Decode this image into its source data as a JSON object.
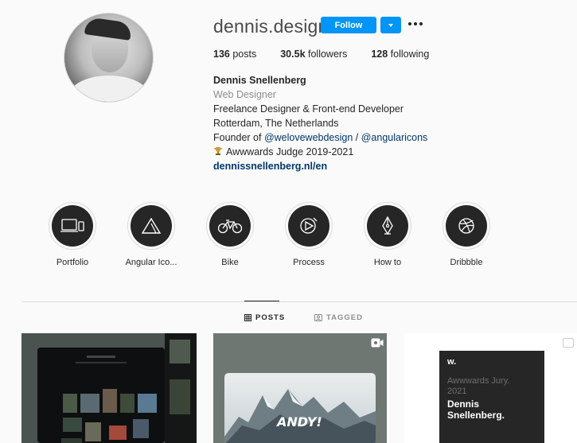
{
  "profile": {
    "username": "dennis.design",
    "follow_label": "Follow",
    "stats": [
      {
        "value": "136",
        "label": "posts"
      },
      {
        "value": "30.5k",
        "label": "followers"
      },
      {
        "value": "128",
        "label": "following"
      }
    ],
    "bio": {
      "name": "Dennis Snellenberg",
      "category": "Web Designer",
      "line1": "Freelance Designer & Front-end Developer",
      "line2": "Rotterdam, The Netherlands",
      "founder_prefix": "Founder of ",
      "mention1": "@welovewebdesign",
      "separator": " / ",
      "mention2": "@angularicons",
      "awwwards": "Awwwards Judge 2019-2021",
      "link": "dennissnellenberg.nl/en"
    }
  },
  "highlights": [
    {
      "label": "Portfolio",
      "icon": "devices-icon"
    },
    {
      "label": "Angular Ico...",
      "icon": "triangle-icon"
    },
    {
      "label": "Bike",
      "icon": "bicycle-icon"
    },
    {
      "label": "Process",
      "icon": "process-icon"
    },
    {
      "label": "How to",
      "icon": "pen-nib-icon"
    },
    {
      "label": "Dribbble",
      "icon": "dribbble-icon"
    }
  ],
  "tabs": {
    "posts": "POSTS",
    "tagged": "TAGGED"
  },
  "posts": [
    {
      "type": "image",
      "theme": "dark-gallery"
    },
    {
      "type": "video",
      "overlay_text": "ANDY!"
    },
    {
      "type": "image",
      "card_logo": "w.",
      "card_line1": "Awwwards Jury.",
      "card_line2": "2021",
      "card_name1": "Dennis",
      "card_name2": "Snellenberg."
    }
  ],
  "colors": {
    "accent": "#0095f6",
    "link": "#00376b",
    "muted": "#8e8e8e"
  }
}
